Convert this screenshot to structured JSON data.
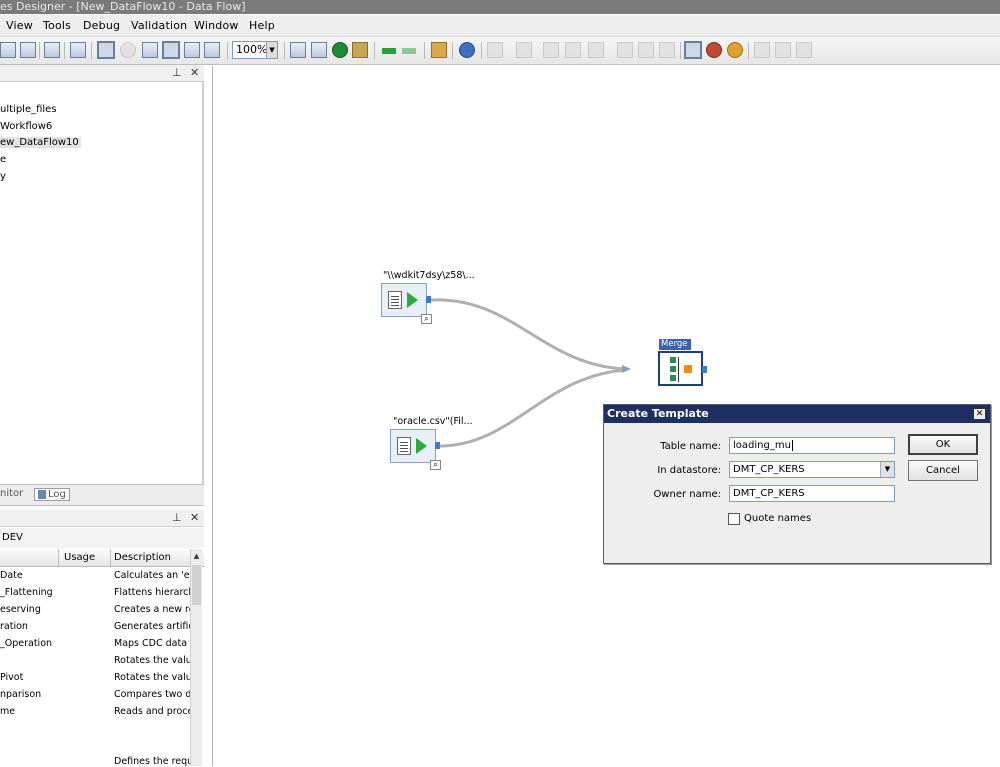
{
  "window": {
    "title": "es Designer - [New_DataFlow10 - Data Flow]"
  },
  "menu": [
    {
      "label": "View"
    },
    {
      "label": "Tools"
    },
    {
      "label": "Debug"
    },
    {
      "label": "Validation"
    },
    {
      "label": "Window"
    },
    {
      "label": "Help"
    }
  ],
  "toolbar": {
    "zoom_value": "100%"
  },
  "project_pane": {
    "tree": [
      {
        "label": "ultiple_files"
      },
      {
        "label": "Workflow6"
      },
      {
        "label": "ew_DataFlow10",
        "selected": true
      },
      {
        "label": "e"
      },
      {
        "label": "y"
      }
    ]
  },
  "bottom_tabs": [
    {
      "label": "nitor"
    },
    {
      "label": "Log"
    }
  ],
  "library_pane": {
    "subheader": "DEV",
    "columns": [
      "Usage",
      "Description"
    ],
    "rows": [
      {
        "name": "Date",
        "description": "Calculates an 'ef"
      },
      {
        "name": "_Flattening",
        "description": "Flattens hierarch"
      },
      {
        "name": "eserving",
        "description": "Creates a new re"
      },
      {
        "name": "ration",
        "description": "Generates artifici"
      },
      {
        "name": "_Operation",
        "description": "Maps CDC data"
      },
      {
        "name": "",
        "description": "Rotates the valu"
      },
      {
        "name": "Pivot",
        "description": "Rotates the valu"
      },
      {
        "name": "nparison",
        "description": "Compares two da"
      },
      {
        "name": "me",
        "description": "Reads and proce"
      },
      {
        "name": "",
        "description": "Defines the requ"
      }
    ]
  },
  "canvas": {
    "source1_label": "\"\\\\wdkit7dsy\\z58\\...",
    "source2_label": "\"oracle.csv\"(Fil...",
    "merge_label": "Merge"
  },
  "dialog": {
    "title": "Create Template",
    "close_glyph": "✕",
    "table_name_label": "Table name:",
    "table_name_value": "loading_mu",
    "datastore_label": "In datastore:",
    "datastore_value": "DMT_CP_KERS",
    "owner_label": "Owner name:",
    "owner_value": "DMT_CP_KERS",
    "quote_label": "Quote names",
    "quote_checked": false,
    "ok_label": "OK",
    "cancel_label": "Cancel"
  }
}
